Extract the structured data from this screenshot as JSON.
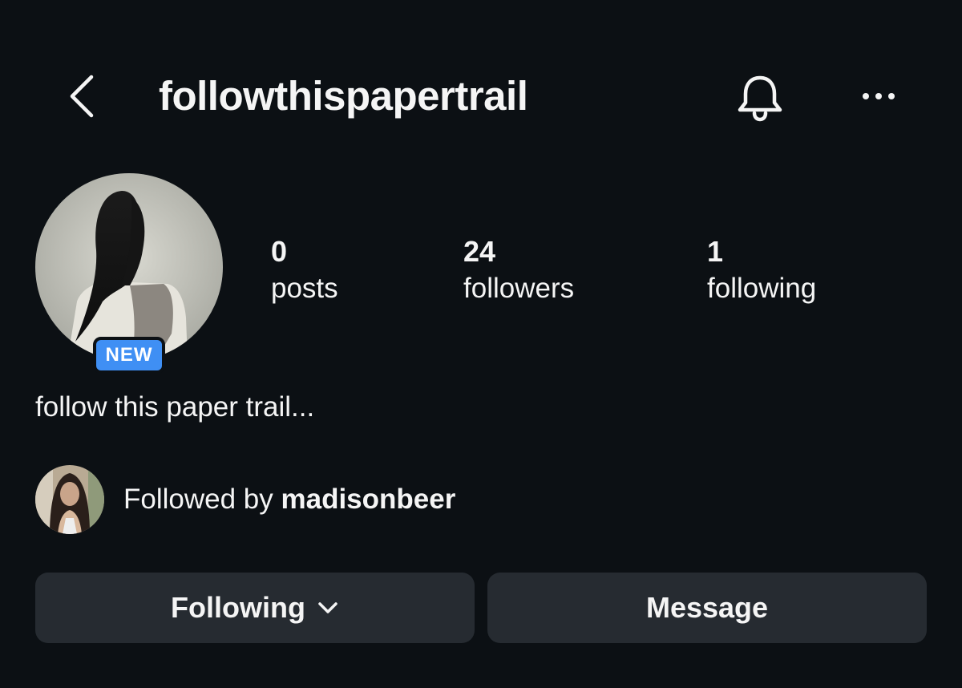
{
  "header": {
    "username": "followthispapertrail",
    "back_icon": "chevron-left-icon",
    "bell_icon": "bell-icon",
    "more_icon": "more-horizontal-icon"
  },
  "profile": {
    "badge": "NEW",
    "stats": {
      "posts": {
        "count": "0",
        "label": "posts"
      },
      "followers": {
        "count": "24",
        "label": "followers"
      },
      "following": {
        "count": "1",
        "label": "following"
      }
    },
    "bio": "follow this paper trail...",
    "followed_by": {
      "prefix": "Followed by ",
      "username": "madisonbeer"
    }
  },
  "actions": {
    "following_label": "Following",
    "message_label": "Message"
  },
  "colors": {
    "background": "#0c1014",
    "button": "#262b31",
    "badge": "#3f8ff4",
    "text": "#f5f5f5"
  }
}
